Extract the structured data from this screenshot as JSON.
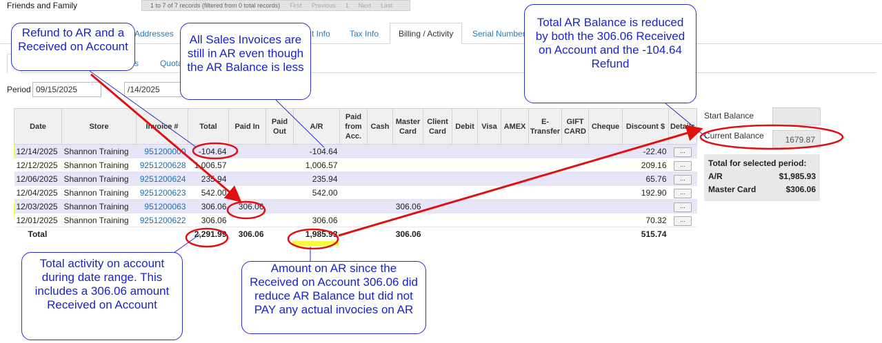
{
  "header": {
    "account_name": "Friends and Family",
    "pager_records": "1 to 7 of 7 records (filtered from 0 total records)",
    "pager_first": "First",
    "pager_previous": "Previous",
    "pager_page": "1",
    "pager_next": "Next",
    "pager_last": "Last"
  },
  "tabs": {
    "addresses": "Addresses",
    "t_info": "t Info",
    "tax_info": "Tax Info",
    "billing_activity": "Billing / Activity",
    "serial_numbers": "Serial Number"
  },
  "subtabs": {
    "s": "s",
    "quota": "Quota"
  },
  "period": {
    "label": "Period",
    "from": "09/15/2025",
    "to": "/14/2025"
  },
  "table": {
    "headers": [
      "Date",
      "Store",
      "Invoice #",
      "Total",
      "Paid In",
      "Paid Out",
      "A/R",
      "Paid from Acc.",
      "Cash",
      "Master Card",
      "Client Card",
      "Debit",
      "Visa",
      "AMEX",
      "E-Transfer",
      "GIFT CARD",
      "Cheque",
      "Discount $",
      "Details"
    ],
    "rows": [
      {
        "date": "12/14/2025",
        "store": "Shannon Training",
        "invoice": "951200000",
        "total": "-104.64",
        "paid_in": "",
        "ar": "-104.64",
        "master_card": "",
        "discount": "-22.40",
        "details": "..."
      },
      {
        "date": "12/12/2025",
        "store": "Shannon Training",
        "invoice": "9251200628",
        "total": "1,006.57",
        "paid_in": "",
        "ar": "1,006.57",
        "master_card": "",
        "discount": "209.16",
        "details": "..."
      },
      {
        "date": "12/06/2025",
        "store": "Shannon Training",
        "invoice": "9251200624",
        "total": "235.94",
        "paid_in": "",
        "ar": "235.94",
        "master_card": "",
        "discount": "65.76",
        "details": "..."
      },
      {
        "date": "12/04/2025",
        "store": "Shannon Training",
        "invoice": "9251200623",
        "total": "542.00",
        "paid_in": "",
        "ar": "542.00",
        "master_card": "",
        "discount": "192.90",
        "details": "..."
      },
      {
        "date": "12/03/2025",
        "store": "Shannon Training",
        "invoice": "951200063",
        "total": "306.06",
        "paid_in": "306.06",
        "ar": "",
        "master_card": "306.06",
        "discount": "",
        "details": "..."
      },
      {
        "date": "12/01/2025",
        "store": "Shannon Training",
        "invoice": "9251200622",
        "total": "306.06",
        "paid_in": "",
        "ar": "306.06",
        "master_card": "",
        "discount": "70.32",
        "details": "..."
      }
    ],
    "totals": {
      "label": "Total",
      "total": "2,291.99",
      "paid_in": "306.06",
      "ar": "1,985.93",
      "master_card": "306.06",
      "discount": "515.74"
    }
  },
  "side": {
    "start_balance_label": "Start Balance",
    "start_balance_value": "",
    "current_balance_label": "Current Balance",
    "current_balance_value": "1679.87",
    "period_title": "Total for selected period:",
    "ar_label": "A/R",
    "ar_value": "$1,985.93",
    "mc_label": "Master Card",
    "mc_value": "$306.06"
  },
  "annotations": {
    "refund": "Refund to AR and a Received on Account",
    "sales_invoices": "All Sales Invoices are still in AR even though the AR Balance is less",
    "total_ar_balance": "Total AR Balance is reduced by both the 306.06 Received on Account and the -104.64 Refund",
    "total_activity": "Total activity on account during date range. This includes a 306.06 amount Received on Account",
    "amount_on_ar": "Amount on AR since the Received on Account 306.06 did reduce AR Balance but did not PAY any actual invocies on AR"
  },
  "colors": {
    "highlight": "#f5f500",
    "callout_text": "#1a24c8",
    "arrow": "#e01010",
    "link": "#1a6fb0",
    "row_alt": "#e6e6f8"
  }
}
